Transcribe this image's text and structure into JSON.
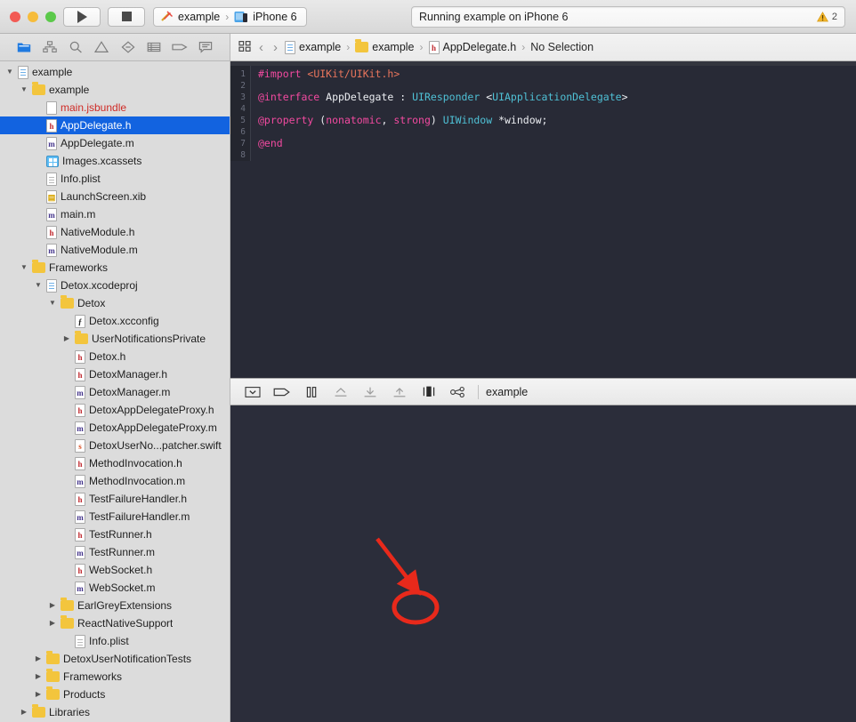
{
  "window": {
    "traffic_lights": [
      "close",
      "minimize",
      "zoom"
    ]
  },
  "toolbar": {
    "run_label": "Run",
    "stop_label": "Stop",
    "scheme_name": "example",
    "destination_name": "iPhone 6",
    "scheme_separator": "›",
    "status_text": "Running example on iPhone 6",
    "warning_count": "2"
  },
  "navigator_toolbar": {
    "icons": [
      {
        "name": "project-navigator-icon",
        "selected": true
      },
      {
        "name": "symbol-navigator-icon",
        "selected": false
      },
      {
        "name": "find-navigator-icon",
        "selected": false
      },
      {
        "name": "issue-navigator-icon",
        "selected": false
      },
      {
        "name": "test-navigator-icon",
        "selected": false
      },
      {
        "name": "debug-navigator-icon",
        "selected": false
      },
      {
        "name": "breakpoint-navigator-icon",
        "selected": false
      },
      {
        "name": "report-navigator-icon",
        "selected": false
      }
    ]
  },
  "jump_bar": {
    "back_glyph": "‹",
    "forward_glyph": "›",
    "separator": "›",
    "crumbs": [
      {
        "label": "example",
        "icon": "project-icon"
      },
      {
        "label": "example",
        "icon": "folder-icon"
      },
      {
        "label": "AppDelegate.h",
        "icon": "header-file-icon"
      },
      {
        "label": "No Selection",
        "icon": "none"
      }
    ]
  },
  "navigator": {
    "rows": [
      {
        "label": "example",
        "indent": 0,
        "twist": "down",
        "icon": "proj",
        "selected": false
      },
      {
        "label": "example",
        "indent": 1,
        "twist": "down",
        "icon": "folder",
        "selected": false
      },
      {
        "label": "main.jsbundle",
        "indent": 2,
        "twist": "none",
        "icon": "plain",
        "selected": false,
        "red": true
      },
      {
        "label": "AppDelegate.h",
        "indent": 2,
        "twist": "none",
        "icon": "h",
        "selected": true
      },
      {
        "label": "AppDelegate.m",
        "indent": 2,
        "twist": "none",
        "icon": "m",
        "selected": false
      },
      {
        "label": "Images.xcassets",
        "indent": 2,
        "twist": "none",
        "icon": "assets",
        "selected": false
      },
      {
        "label": "Info.plist",
        "indent": 2,
        "twist": "none",
        "icon": "plist",
        "selected": false
      },
      {
        "label": "LaunchScreen.xib",
        "indent": 2,
        "twist": "none",
        "icon": "xib",
        "selected": false
      },
      {
        "label": "main.m",
        "indent": 2,
        "twist": "none",
        "icon": "m",
        "selected": false
      },
      {
        "label": "NativeModule.h",
        "indent": 2,
        "twist": "none",
        "icon": "h",
        "selected": false
      },
      {
        "label": "NativeModule.m",
        "indent": 2,
        "twist": "none",
        "icon": "m",
        "selected": false
      },
      {
        "label": "Frameworks",
        "indent": 1,
        "twist": "down",
        "icon": "folder",
        "selected": false
      },
      {
        "label": "Detox.xcodeproj",
        "indent": 2,
        "twist": "down",
        "icon": "proj",
        "selected": false
      },
      {
        "label": "Detox",
        "indent": 3,
        "twist": "down",
        "icon": "folder",
        "selected": false
      },
      {
        "label": "Detox.xcconfig",
        "indent": 4,
        "twist": "none",
        "icon": "xcconfig",
        "selected": false
      },
      {
        "label": "UserNotificationsPrivate",
        "indent": 4,
        "twist": "right",
        "icon": "folder",
        "selected": false
      },
      {
        "label": "Detox.h",
        "indent": 4,
        "twist": "none",
        "icon": "h",
        "selected": false
      },
      {
        "label": "DetoxManager.h",
        "indent": 4,
        "twist": "none",
        "icon": "h",
        "selected": false
      },
      {
        "label": "DetoxManager.m",
        "indent": 4,
        "twist": "none",
        "icon": "m",
        "selected": false
      },
      {
        "label": "DetoxAppDelegateProxy.h",
        "indent": 4,
        "twist": "none",
        "icon": "h",
        "selected": false
      },
      {
        "label": "DetoxAppDelegateProxy.m",
        "indent": 4,
        "twist": "none",
        "icon": "m",
        "selected": false
      },
      {
        "label": "DetoxUserNo...patcher.swift",
        "indent": 4,
        "twist": "none",
        "icon": "swift",
        "selected": false
      },
      {
        "label": "MethodInvocation.h",
        "indent": 4,
        "twist": "none",
        "icon": "h",
        "selected": false
      },
      {
        "label": "MethodInvocation.m",
        "indent": 4,
        "twist": "none",
        "icon": "m",
        "selected": false
      },
      {
        "label": "TestFailureHandler.h",
        "indent": 4,
        "twist": "none",
        "icon": "h",
        "selected": false
      },
      {
        "label": "TestFailureHandler.m",
        "indent": 4,
        "twist": "none",
        "icon": "m",
        "selected": false
      },
      {
        "label": "TestRunner.h",
        "indent": 4,
        "twist": "none",
        "icon": "h",
        "selected": false
      },
      {
        "label": "TestRunner.m",
        "indent": 4,
        "twist": "none",
        "icon": "m",
        "selected": false
      },
      {
        "label": "WebSocket.h",
        "indent": 4,
        "twist": "none",
        "icon": "h",
        "selected": false
      },
      {
        "label": "WebSocket.m",
        "indent": 4,
        "twist": "none",
        "icon": "m",
        "selected": false
      },
      {
        "label": "EarlGreyExtensions",
        "indent": 3,
        "twist": "right",
        "icon": "folder",
        "selected": false
      },
      {
        "label": "ReactNativeSupport",
        "indent": 3,
        "twist": "right",
        "icon": "folder",
        "selected": false
      },
      {
        "label": "Info.plist",
        "indent": 4,
        "twist": "none",
        "icon": "plist",
        "selected": false
      },
      {
        "label": "DetoxUserNotificationTests",
        "indent": 2,
        "twist": "right",
        "icon": "folder",
        "selected": false
      },
      {
        "label": "Frameworks",
        "indent": 2,
        "twist": "right",
        "icon": "folder",
        "selected": false
      },
      {
        "label": "Products",
        "indent": 2,
        "twist": "right",
        "icon": "folder",
        "selected": false
      },
      {
        "label": "Libraries",
        "indent": 1,
        "twist": "right",
        "icon": "folder",
        "selected": false
      }
    ]
  },
  "editor": {
    "file_name": "AppDelegate.h",
    "line_numbers": [
      "1",
      "2",
      "3",
      "4",
      "5",
      "6",
      "7",
      "8"
    ],
    "lines": [
      [
        {
          "t": "#import ",
          "c": "k-pink"
        },
        {
          "t": "<UIKit/UIKit.h>",
          "c": "k-orange"
        }
      ],
      [],
      [
        {
          "t": "@interface ",
          "c": "k-pink"
        },
        {
          "t": "AppDelegate ",
          "c": "k-white"
        },
        {
          "t": ": ",
          "c": "k-white"
        },
        {
          "t": "UIResponder ",
          "c": "k-cyan"
        },
        {
          "t": "<",
          "c": "k-white"
        },
        {
          "t": "UIApplicationDelegate",
          "c": "k-cyan"
        },
        {
          "t": ">",
          "c": "k-white"
        }
      ],
      [],
      [
        {
          "t": "@property ",
          "c": "k-pink"
        },
        {
          "t": "(",
          "c": "k-white"
        },
        {
          "t": "nonatomic",
          "c": "k-pink"
        },
        {
          "t": ", ",
          "c": "k-white"
        },
        {
          "t": "strong",
          "c": "k-pink"
        },
        {
          "t": ") ",
          "c": "k-white"
        },
        {
          "t": "UIWindow ",
          "c": "k-cyan"
        },
        {
          "t": "*window;",
          "c": "k-white"
        }
      ],
      [],
      [
        {
          "t": "@end",
          "c": "k-pink"
        }
      ],
      []
    ]
  },
  "debug_bar": {
    "icons": [
      {
        "name": "hide-debug-area-icon",
        "highlighted": false
      },
      {
        "name": "activate-breakpoints-icon",
        "highlighted": false
      },
      {
        "name": "pause-continue-icon",
        "highlighted": false
      },
      {
        "name": "step-over-icon",
        "highlighted": false
      },
      {
        "name": "step-into-icon",
        "highlighted": false
      },
      {
        "name": "step-out-icon",
        "highlighted": false
      },
      {
        "name": "debug-view-hierarchy-icon",
        "highlighted": true
      },
      {
        "name": "simulate-location-icon",
        "highlighted": false
      }
    ],
    "process_label": "example"
  },
  "annotation": {
    "arrow_color": "#e8291b",
    "circle_color": "#e8291b",
    "target_icon": "debug-view-hierarchy-icon"
  }
}
